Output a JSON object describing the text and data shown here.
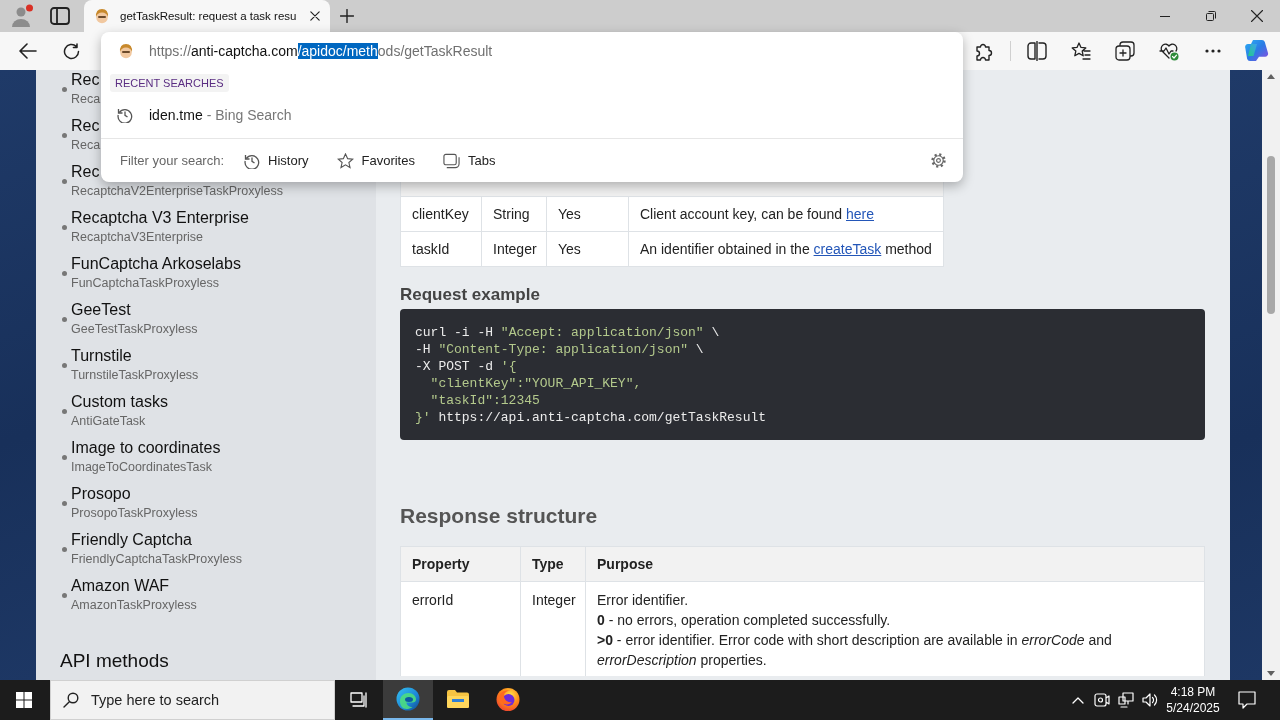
{
  "browser": {
    "tabs": [
      {
        "title": "getTaskResult: request a task resu",
        "selected": true
      }
    ],
    "address_dropdown": {
      "url": [
        {
          "text": "https://",
          "kind": "dim"
        },
        {
          "text": "anti-captcha.com",
          "kind": "host"
        },
        {
          "text": "/apidoc/meth",
          "kind": "selected"
        },
        {
          "text": "ods/getTaskResult",
          "kind": "dim"
        }
      ],
      "section_label": "RECENT SEARCHES",
      "suggestions": [
        {
          "query": "iden.tme",
          "source": "- Bing Search"
        }
      ],
      "filter_label": "Filter your search:",
      "filters": [
        {
          "label": "History",
          "kind": "history"
        },
        {
          "label": "Favorites",
          "kind": "favorites"
        },
        {
          "label": "Tabs",
          "kind": "tabs"
        }
      ]
    }
  },
  "sidebar": {
    "items": [
      {
        "title": "Rec",
        "subtitle": "Reca"
      },
      {
        "title": "Rec",
        "subtitle": "Reca"
      },
      {
        "title": "Rec",
        "subtitle": "RecaptchaV2EnterpriseTaskProxyless"
      },
      {
        "title": "Recaptcha V3 Enterprise",
        "subtitle": "RecaptchaV3Enterprise"
      },
      {
        "title": "FunCaptcha Arkoselabs",
        "subtitle": "FunCaptchaTaskProxyless"
      },
      {
        "title": "GeeTest",
        "subtitle": "GeeTestTaskProxyless"
      },
      {
        "title": "Turnstile",
        "subtitle": "TurnstileTaskProxyless"
      },
      {
        "title": "Custom tasks",
        "subtitle": "AntiGateTask"
      },
      {
        "title": "Image to coordinates",
        "subtitle": "ImageToCoordinatesTask"
      },
      {
        "title": "Prosopo",
        "subtitle": "ProsopoTaskProxyless"
      },
      {
        "title": "Friendly Captcha",
        "subtitle": "FriendlyCaptchaTaskProxyless"
      },
      {
        "title": "Amazon WAF",
        "subtitle": "AmazonTaskProxyless"
      }
    ],
    "section_heading": "API methods"
  },
  "content": {
    "parameters_table": {
      "rows": [
        {
          "property": "clientKey",
          "type": "String",
          "required": "Yes",
          "purpose": {
            "text": "Client account key, can be found ",
            "link": "here"
          }
        },
        {
          "property": "taskId",
          "type": "Integer",
          "required": "Yes",
          "purpose": {
            "text": "An identifier obtained in the ",
            "link": "createTask",
            "after": " method"
          }
        }
      ]
    },
    "request_heading": "Request example",
    "code_lines": [
      [
        {
          "text": "curl -i -H ",
          "kind": "plain"
        },
        {
          "text": "\"Accept: application/json\"",
          "kind": "string"
        },
        {
          "text": " \\",
          "kind": "plain"
        }
      ],
      [
        {
          "text": "-H ",
          "kind": "plain"
        },
        {
          "text": "\"Content-Type: application/json\"",
          "kind": "string"
        },
        {
          "text": " \\",
          "kind": "plain"
        }
      ],
      [
        {
          "text": "-X POST -d ",
          "kind": "plain"
        },
        {
          "text": "'{",
          "kind": "string"
        }
      ],
      [
        {
          "text": "  \"clientKey\":\"YOUR_API_KEY\",",
          "kind": "string"
        }
      ],
      [
        {
          "text": "  \"taskId\":12345",
          "kind": "string"
        }
      ],
      [
        {
          "text": "}'",
          "kind": "string"
        },
        {
          "text": " https://api.anti-captcha.com/getTaskResult",
          "kind": "plain"
        }
      ]
    ],
    "response_heading": "Response structure",
    "response_table": {
      "columns": [
        "Property",
        "Type",
        "Purpose"
      ],
      "rows": [
        {
          "property": "errorId",
          "type": "Integer",
          "purpose": [
            "Error identifier.",
            "**0** - no errors, operation completed successfully.",
            "**>0** - error identifier. Error code with short description are available in *errorCode* and *errorDescription* properties."
          ]
        }
      ]
    }
  },
  "taskbar": {
    "search": {
      "placeholder": "Type here to search"
    },
    "apps": [
      {
        "kind": "edge",
        "selected": true
      },
      {
        "kind": "explorer",
        "selected": false
      },
      {
        "kind": "firefox",
        "selected": false
      }
    ],
    "time": "4:18 PM",
    "date": "5/24/2025"
  }
}
